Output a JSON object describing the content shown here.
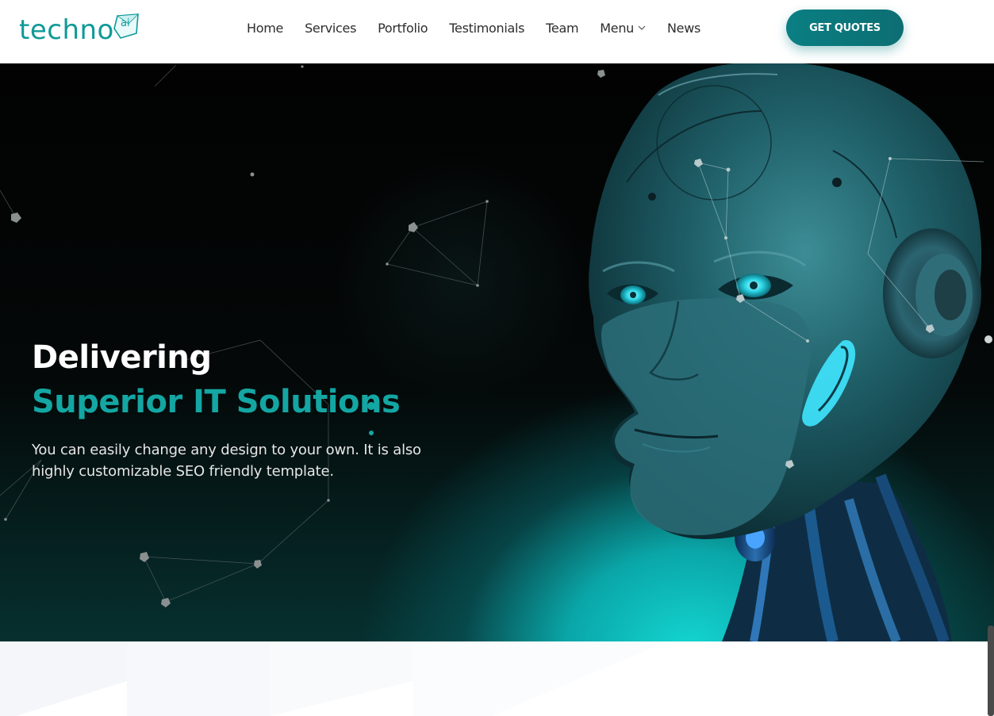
{
  "brand": {
    "name": "techno",
    "badge": "ai",
    "accent": "#0f9a98"
  },
  "nav": {
    "items": [
      {
        "label": "Home"
      },
      {
        "label": "Services"
      },
      {
        "label": "Portfolio"
      },
      {
        "label": "Testimonials"
      },
      {
        "label": "Team"
      },
      {
        "label": "Menu",
        "has_dropdown": true,
        "icon": "chevron-down-icon"
      },
      {
        "label": "News"
      }
    ]
  },
  "header": {
    "cta_label": "GET QUOTES",
    "cta_color": "#0a7f83"
  },
  "hero": {
    "title_line1": "Delivering",
    "title_line2": "Superior IT Solutions",
    "description": "You can easily change any design to your own. It is also highly customizable SEO friendly template.",
    "title_color": "#ffffff",
    "highlight_color": "#14a6a3",
    "image": "robot-head-illustration"
  }
}
